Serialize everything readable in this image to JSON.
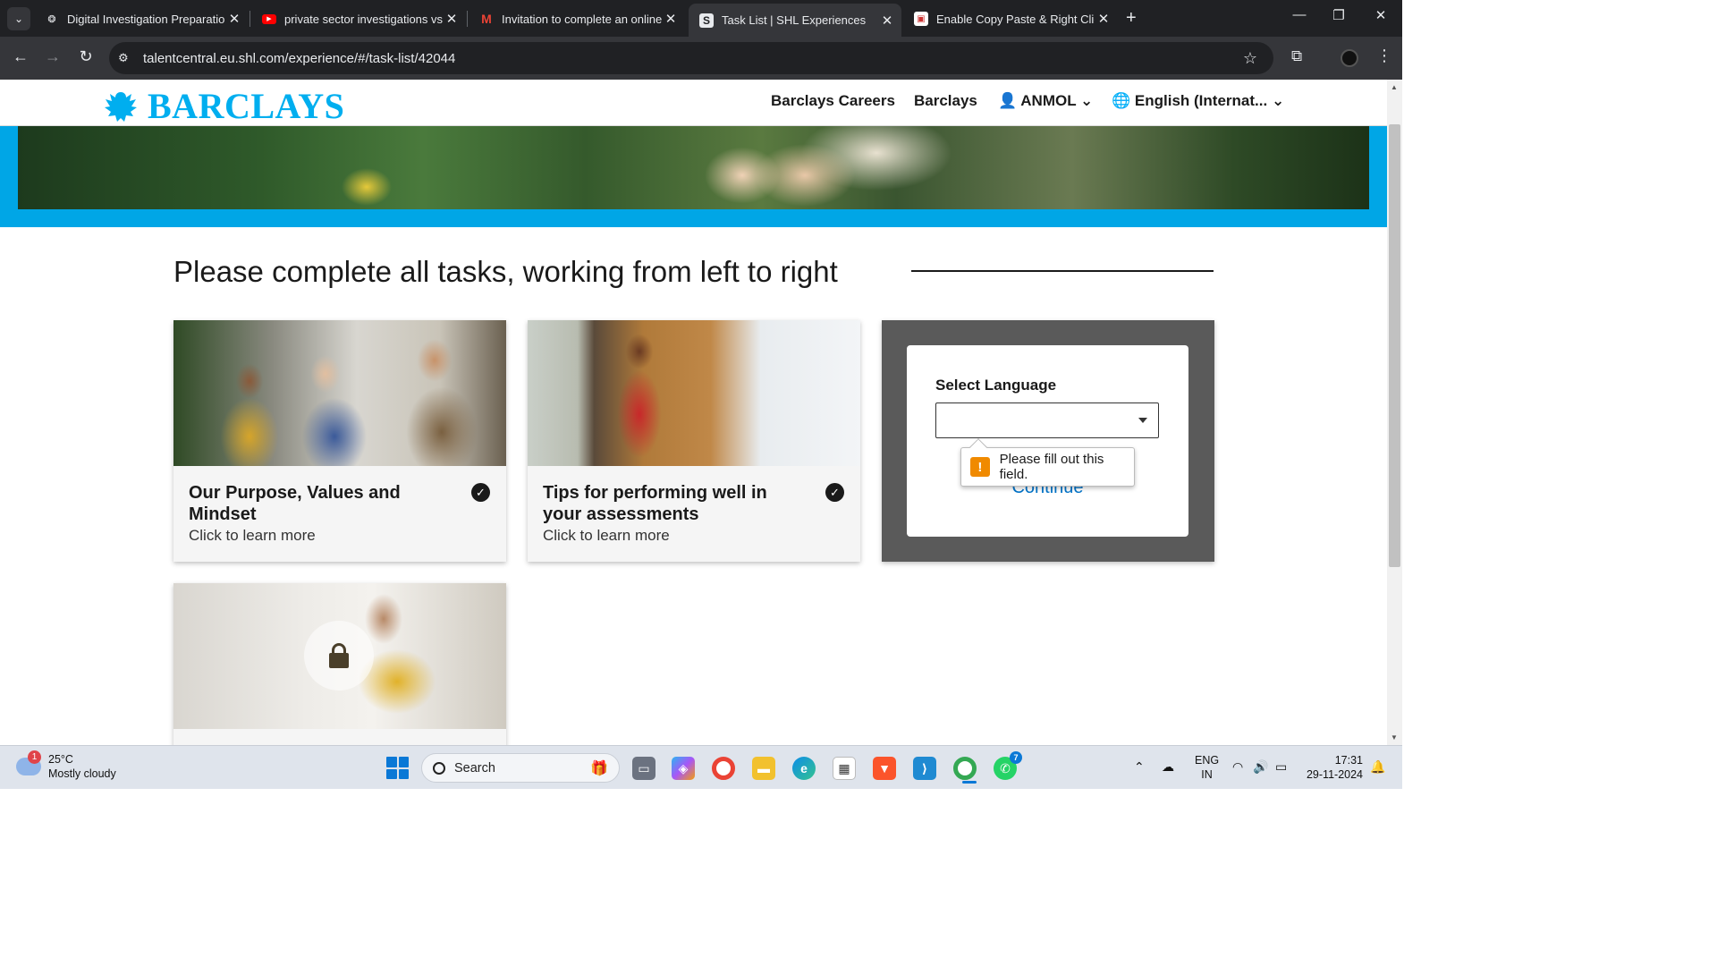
{
  "browser": {
    "tabs": [
      {
        "title": "Digital Investigation Preparation",
        "favicon": "openai-icon"
      },
      {
        "title": "private sector investigations vs",
        "favicon": "youtube-icon"
      },
      {
        "title": "Invitation to complete an online",
        "favicon": "gmail-icon"
      },
      {
        "title": "Task List | SHL Experiences",
        "favicon": "shl-icon",
        "active": true
      },
      {
        "title": "Enable Copy Paste & Right Click",
        "favicon": "extension-icon"
      }
    ],
    "url": "talentcentral.eu.shl.com/experience/#/task-list/42044"
  },
  "site": {
    "logo_text": "BARCLAYS",
    "nav": {
      "careers": "Barclays Careers",
      "barclays": "Barclays",
      "user": "ANMOL",
      "language": "English (Internat..."
    }
  },
  "main": {
    "heading": "Please complete all tasks, working from left to right",
    "cards": [
      {
        "title": "Our Purpose, Values and Mindset",
        "subtitle": "Click to learn more",
        "completed": true
      },
      {
        "title": "Tips for performing well in your assessments",
        "subtitle": "Click to learn more",
        "completed": true
      }
    ],
    "language_modal": {
      "label": "Select Language",
      "selected": "",
      "continue_label": "Continue",
      "validation_message": "Please fill out this field."
    },
    "locked_card": {
      "locked": true
    }
  },
  "taskbar": {
    "weather_temp": "25°C",
    "weather_desc": "Mostly cloudy",
    "weather_badge": "1",
    "search_placeholder": "Search",
    "whatsapp_badge": "7",
    "lang_line1": "ENG",
    "lang_line2": "IN",
    "time": "17:31",
    "date": "29-11-2024"
  },
  "colors": {
    "brand": "#00aeef",
    "link": "#0073c8",
    "warning": "#f08a00"
  }
}
